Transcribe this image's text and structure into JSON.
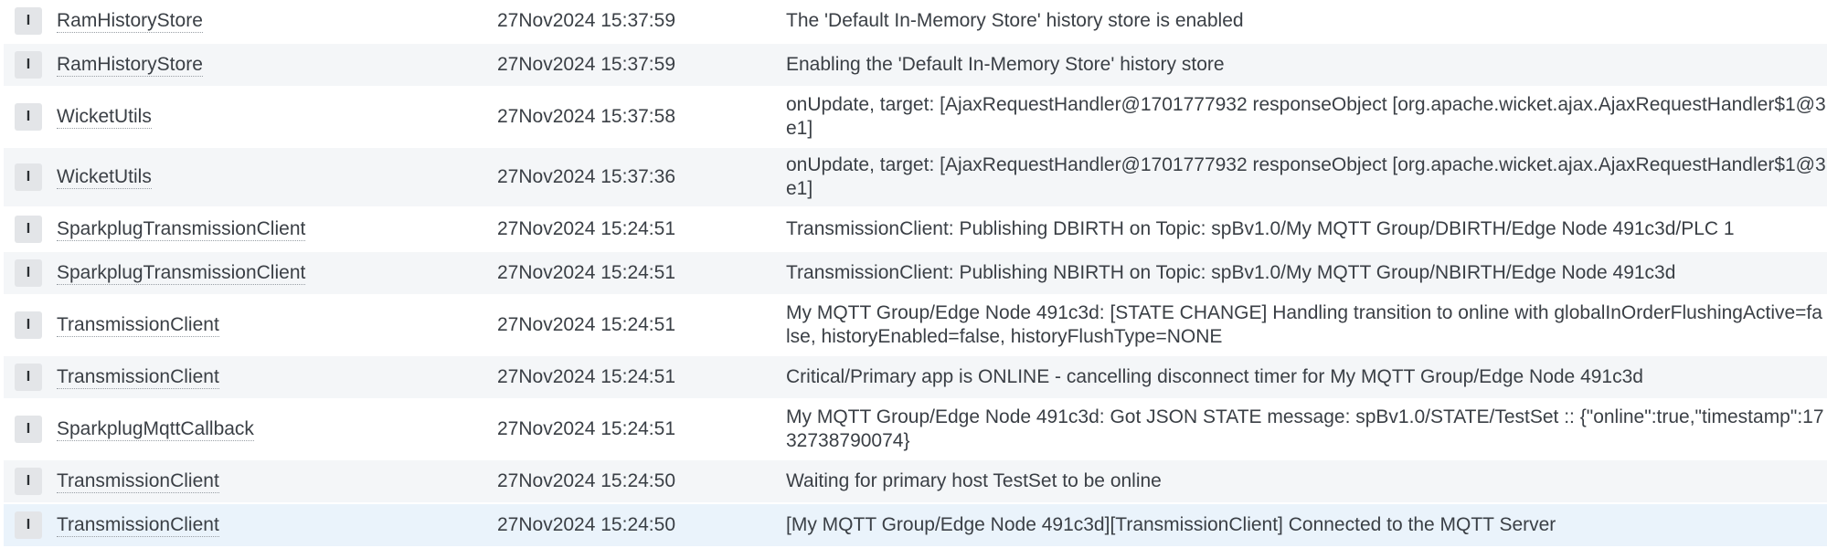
{
  "log": {
    "rows": [
      {
        "level": "I",
        "logger": "RamHistoryStore",
        "timestamp": "27Nov2024 15:37:59",
        "message": "The 'Default In-Memory Store' history store is enabled"
      },
      {
        "level": "I",
        "logger": "RamHistoryStore",
        "timestamp": "27Nov2024 15:37:59",
        "message": "Enabling the 'Default In-Memory Store' history store"
      },
      {
        "level": "I",
        "logger": "WicketUtils",
        "timestamp": "27Nov2024 15:37:58",
        "message": "onUpdate, target: [AjaxRequestHandler@1701777932 responseObject [org.apache.wicket.ajax.AjaxRequestHandler$1@3e1]"
      },
      {
        "level": "I",
        "logger": "WicketUtils",
        "timestamp": "27Nov2024 15:37:36",
        "message": "onUpdate, target: [AjaxRequestHandler@1701777932 responseObject [org.apache.wicket.ajax.AjaxRequestHandler$1@3e1]"
      },
      {
        "level": "I",
        "logger": "SparkplugTransmissionClient",
        "timestamp": "27Nov2024 15:24:51",
        "message": "TransmissionClient: Publishing DBIRTH on Topic: spBv1.0/My MQTT Group/DBIRTH/Edge Node 491c3d/PLC 1"
      },
      {
        "level": "I",
        "logger": "SparkplugTransmissionClient",
        "timestamp": "27Nov2024 15:24:51",
        "message": "TransmissionClient: Publishing NBIRTH on Topic: spBv1.0/My MQTT Group/NBIRTH/Edge Node 491c3d"
      },
      {
        "level": "I",
        "logger": "TransmissionClient",
        "timestamp": "27Nov2024 15:24:51",
        "message": "My MQTT Group/Edge Node 491c3d: [STATE CHANGE] Handling transition to online with globalInOrderFlushingActive=false, historyEnabled=false, historyFlushType=NONE"
      },
      {
        "level": "I",
        "logger": "TransmissionClient",
        "timestamp": "27Nov2024 15:24:51",
        "message": "Critical/Primary app is ONLINE - cancelling disconnect timer for My MQTT Group/Edge Node 491c3d"
      },
      {
        "level": "I",
        "logger": "SparkplugMqttCallback",
        "timestamp": "27Nov2024 15:24:51",
        "message": "My MQTT Group/Edge Node 491c3d: Got JSON STATE message: spBv1.0/STATE/TestSet :: {\"online\":true,\"timestamp\":1732738790074}"
      },
      {
        "level": "I",
        "logger": "TransmissionClient",
        "timestamp": "27Nov2024 15:24:50",
        "message": "Waiting for primary host TestSet to be online"
      },
      {
        "level": "I",
        "logger": "TransmissionClient",
        "timestamp": "27Nov2024 15:24:50",
        "message": "[My MQTT Group/Edge Node 491c3d][TransmissionClient] Connected to the MQTT Server"
      }
    ]
  }
}
